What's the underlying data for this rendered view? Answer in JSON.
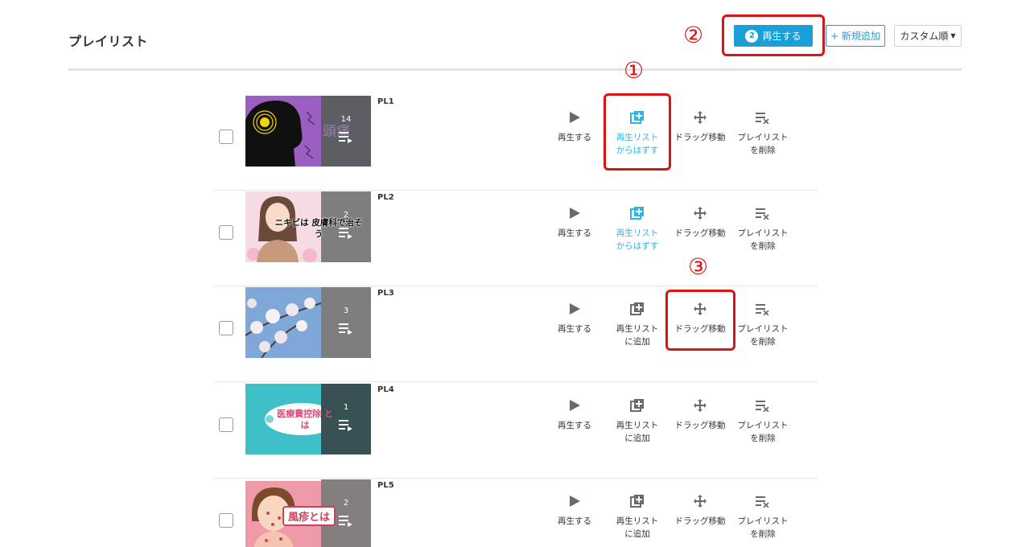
{
  "header": {
    "title": "プレイリスト",
    "play_button": {
      "count": "2",
      "label": "再生する"
    },
    "add_button": "+ 新規追加",
    "sort_button": "カスタム順"
  },
  "callouts": [
    "②",
    "①",
    "③"
  ],
  "icons": {
    "play": "play-icon",
    "queue_add": "queue-add-icon",
    "drag": "drag-move-icon",
    "delete": "playlist-remove-icon",
    "playlist": "playlist-icon"
  },
  "colors": {
    "accent": "#1a9fd8",
    "annotation": "#d91414",
    "active_action": "#2ab5e6"
  },
  "rows": [
    {
      "name": "PL1",
      "count": "14",
      "thumb_text": "頭痛",
      "actions": {
        "play": "再生する",
        "queue_line1": "再生リスト",
        "queue_line2": "からはずす",
        "drag": "ドラッグ移動",
        "delete_line1": "プレイリスト",
        "delete_line2": "を削除"
      }
    },
    {
      "name": "PL2",
      "count": "2",
      "thumb_text": "ニキビは 皮膚科で治そう",
      "actions": {
        "play": "再生する",
        "queue_line1": "再生リスト",
        "queue_line2": "からはずす",
        "drag": "ドラッグ移動",
        "delete_line1": "プレイリスト",
        "delete_line2": "を削除"
      }
    },
    {
      "name": "PL3",
      "count": "3",
      "thumb_text": "",
      "actions": {
        "play": "再生する",
        "queue_line1": "再生リスト",
        "queue_line2": "に追加",
        "drag": "ドラッグ移動",
        "delete_line1": "プレイリスト",
        "delete_line2": "を削除"
      }
    },
    {
      "name": "PL4",
      "count": "1",
      "thumb_text": "医療費控除 とは",
      "actions": {
        "play": "再生する",
        "queue_line1": "再生リスト",
        "queue_line2": "に追加",
        "drag": "ドラッグ移動",
        "delete_line1": "プレイリスト",
        "delete_line2": "を削除"
      }
    },
    {
      "name": "PL5",
      "count": "2",
      "thumb_text": "風疹とは",
      "actions": {
        "play": "再生する",
        "queue_line1": "再生リスト",
        "queue_line2": "に追加",
        "drag": "ドラッグ移動",
        "delete_line1": "プレイリスト",
        "delete_line2": "を削除"
      }
    }
  ]
}
